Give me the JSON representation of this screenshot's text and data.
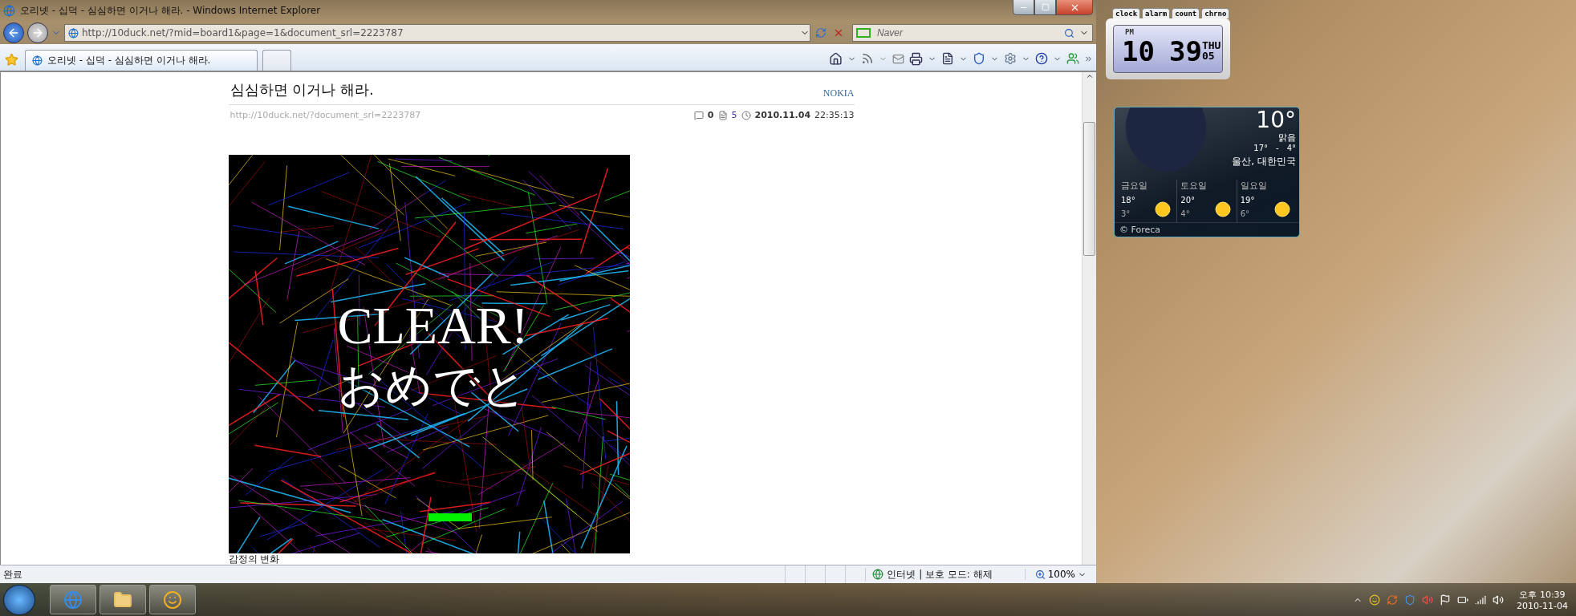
{
  "window": {
    "title": "오리넷 - 십덕 - 심심하면 이거나 해라. - Windows Internet Explorer"
  },
  "address_bar": {
    "url": "http://10duck.net/?mid=board1&page=1&document_srl=2223787"
  },
  "search": {
    "placeholder": "Naver"
  },
  "tabs": [
    {
      "label": "오리넷 - 십덕 - 심심하면 이거나 해라.",
      "selected": true
    }
  ],
  "article": {
    "title": "심심하면 이거나 해라.",
    "author": "NOKIA",
    "permalink": "http://10duck.net/?document_srl=2223787",
    "comments": "0",
    "views": "5",
    "date": "2010.11.04",
    "time": "22:35:13",
    "game": {
      "line1": "CLEAR!",
      "line2": "おめでと"
    },
    "caption": "감정의 변화"
  },
  "status_bar": {
    "text": "완료",
    "zone": "인터넷 | 보호 모드: 해제",
    "zoom": "100%"
  },
  "taskbar": {
    "time": "오후 10:39",
    "date": "2010-11-04"
  },
  "clock_gadget": {
    "tabs": [
      "clock",
      "alarm",
      "count",
      "chrno"
    ],
    "ampm": "PM",
    "hour": "10",
    "minute": "39",
    "weekday": "THU",
    "day": "05"
  },
  "weather_gadget": {
    "temperature": "10°",
    "condition": "맑음",
    "high": "17°",
    "separator": "-",
    "low": "4°",
    "location": "울산, 대한민국",
    "forecast": [
      {
        "day": "금요일",
        "high": "18°",
        "low": "3°"
      },
      {
        "day": "토요일",
        "high": "20°",
        "low": "4°"
      },
      {
        "day": "일요일",
        "high": "19°",
        "low": "6°"
      }
    ],
    "credit": "© Foreca"
  }
}
